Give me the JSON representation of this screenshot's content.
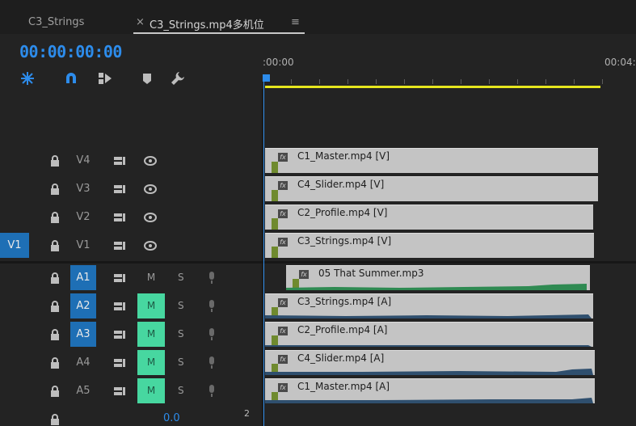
{
  "tabs": [
    {
      "label": "C3_Strings"
    },
    {
      "label": "×"
    },
    {
      "label": "C3_Strings.mp4多机位"
    },
    {
      "label": "≡"
    }
  ],
  "timecode": "00:00:00:00",
  "ruler": {
    "start_label": ":00:00",
    "end_label": "00:04:"
  },
  "tracks": {
    "video": [
      {
        "name": "V4"
      },
      {
        "name": "V3"
      },
      {
        "name": "V2"
      },
      {
        "name": "V1",
        "target": "V1"
      }
    ],
    "audio": [
      {
        "name": "A1",
        "mute": "M",
        "solo": "S"
      },
      {
        "name": "A2",
        "mute": "M",
        "solo": "S"
      },
      {
        "name": "A3",
        "mute": "M",
        "solo": "S"
      },
      {
        "name": "A4",
        "mute": "M",
        "solo": "S"
      },
      {
        "name": "A5",
        "mute": "M",
        "solo": "S"
      }
    ]
  },
  "clips": {
    "v4": "C1_Master.mp4 [V]",
    "v3": "C4_Slider.mp4 [V]",
    "v2": "C2_Profile.mp4 [V]",
    "v1": "C3_Strings.mp4 [V]",
    "a1": "05 That Summer.mp3",
    "a2": "C3_Strings.mp4 [A]",
    "a3": "C2_Profile.mp4 [A]",
    "a4": "C4_Slider.mp4 [A]",
    "a5": "C1_Master.mp4 [A]"
  },
  "clip_fx": "fx",
  "footer": {
    "volume": "0.0",
    "meter": "2"
  },
  "colors": {
    "accent": "#2d8ceb",
    "mute_on": "#47d7a0",
    "work_area": "#e6e61e",
    "target": "#1e6fb5"
  }
}
